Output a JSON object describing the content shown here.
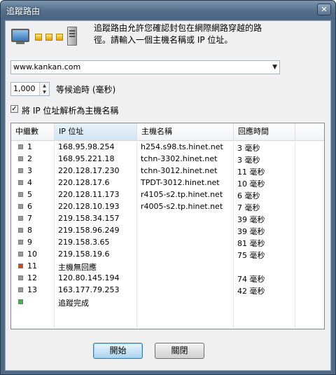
{
  "window": {
    "title": "追蹤路由",
    "close_glyph": "✕"
  },
  "header": {
    "icons": [
      "monitor-icon",
      "dots-icon",
      "server-icon"
    ],
    "description": "追蹤路由允許您確認封包在網際網路穿越的路徑。請輸入一個主機名稱或 IP 位址。"
  },
  "target": {
    "value": "www.kankan.com",
    "arrow": "▼"
  },
  "timeout": {
    "value": "1,000",
    "label": "等候逾時 (毫秒)",
    "up": "▲",
    "down": "▼"
  },
  "resolve": {
    "checked": true,
    "mark": "✓",
    "label": "將 IP 位址解析為主機名稱"
  },
  "columns": [
    "中繼數",
    "IP 位址",
    "主機名稱",
    "回應時間"
  ],
  "hops": [
    {
      "hop": "1",
      "ip": "168.95.98.254",
      "host": "h254.s98.ts.hinet.net",
      "time": "3 毫秒",
      "status": "ok"
    },
    {
      "hop": "2",
      "ip": "168.95.221.18",
      "host": "tchn-3302.hinet.net",
      "time": "3 毫秒",
      "status": "ok"
    },
    {
      "hop": "3",
      "ip": "220.128.17.230",
      "host": "tchn-3012.hinet.net",
      "time": "11 毫秒",
      "status": "ok"
    },
    {
      "hop": "4",
      "ip": "220.128.17.6",
      "host": "TPDT-3012.hinet.net",
      "time": "10 毫秒",
      "status": "ok"
    },
    {
      "hop": "5",
      "ip": "220.128.11.173",
      "host": "r4105-s2.tp.hinet.net",
      "time": "6 毫秒",
      "status": "ok"
    },
    {
      "hop": "6",
      "ip": "220.128.10.193",
      "host": "r4005-s2.tp.hinet.net",
      "time": "7 毫秒",
      "status": "ok"
    },
    {
      "hop": "7",
      "ip": "219.158.34.157",
      "host": "",
      "time": "39 毫秒",
      "status": "ok"
    },
    {
      "hop": "8",
      "ip": "219.158.96.249",
      "host": "",
      "time": "39 毫秒",
      "status": "ok"
    },
    {
      "hop": "9",
      "ip": "219.158.3.65",
      "host": "",
      "time": "81 毫秒",
      "status": "ok"
    },
    {
      "hop": "10",
      "ip": "219.158.19.6",
      "host": "",
      "time": "75 毫秒",
      "status": "ok"
    },
    {
      "hop": "11",
      "ip": "主機無回應",
      "host": "",
      "time": "",
      "status": "error"
    },
    {
      "hop": "12",
      "ip": "120.80.145.194",
      "host": "",
      "time": "74 毫秒",
      "status": "ok"
    },
    {
      "hop": "13",
      "ip": "163.177.79.253",
      "host": "",
      "time": "42 毫秒",
      "status": "ok"
    },
    {
      "hop": "",
      "ip": "追蹤完成",
      "host": "",
      "time": "",
      "status": "done"
    }
  ],
  "status_colors": {
    "ok": "#9a9a9a",
    "error": "#e0401a",
    "done": "#3cb83c"
  },
  "buttons": {
    "start": "開始",
    "close": "關閉"
  }
}
